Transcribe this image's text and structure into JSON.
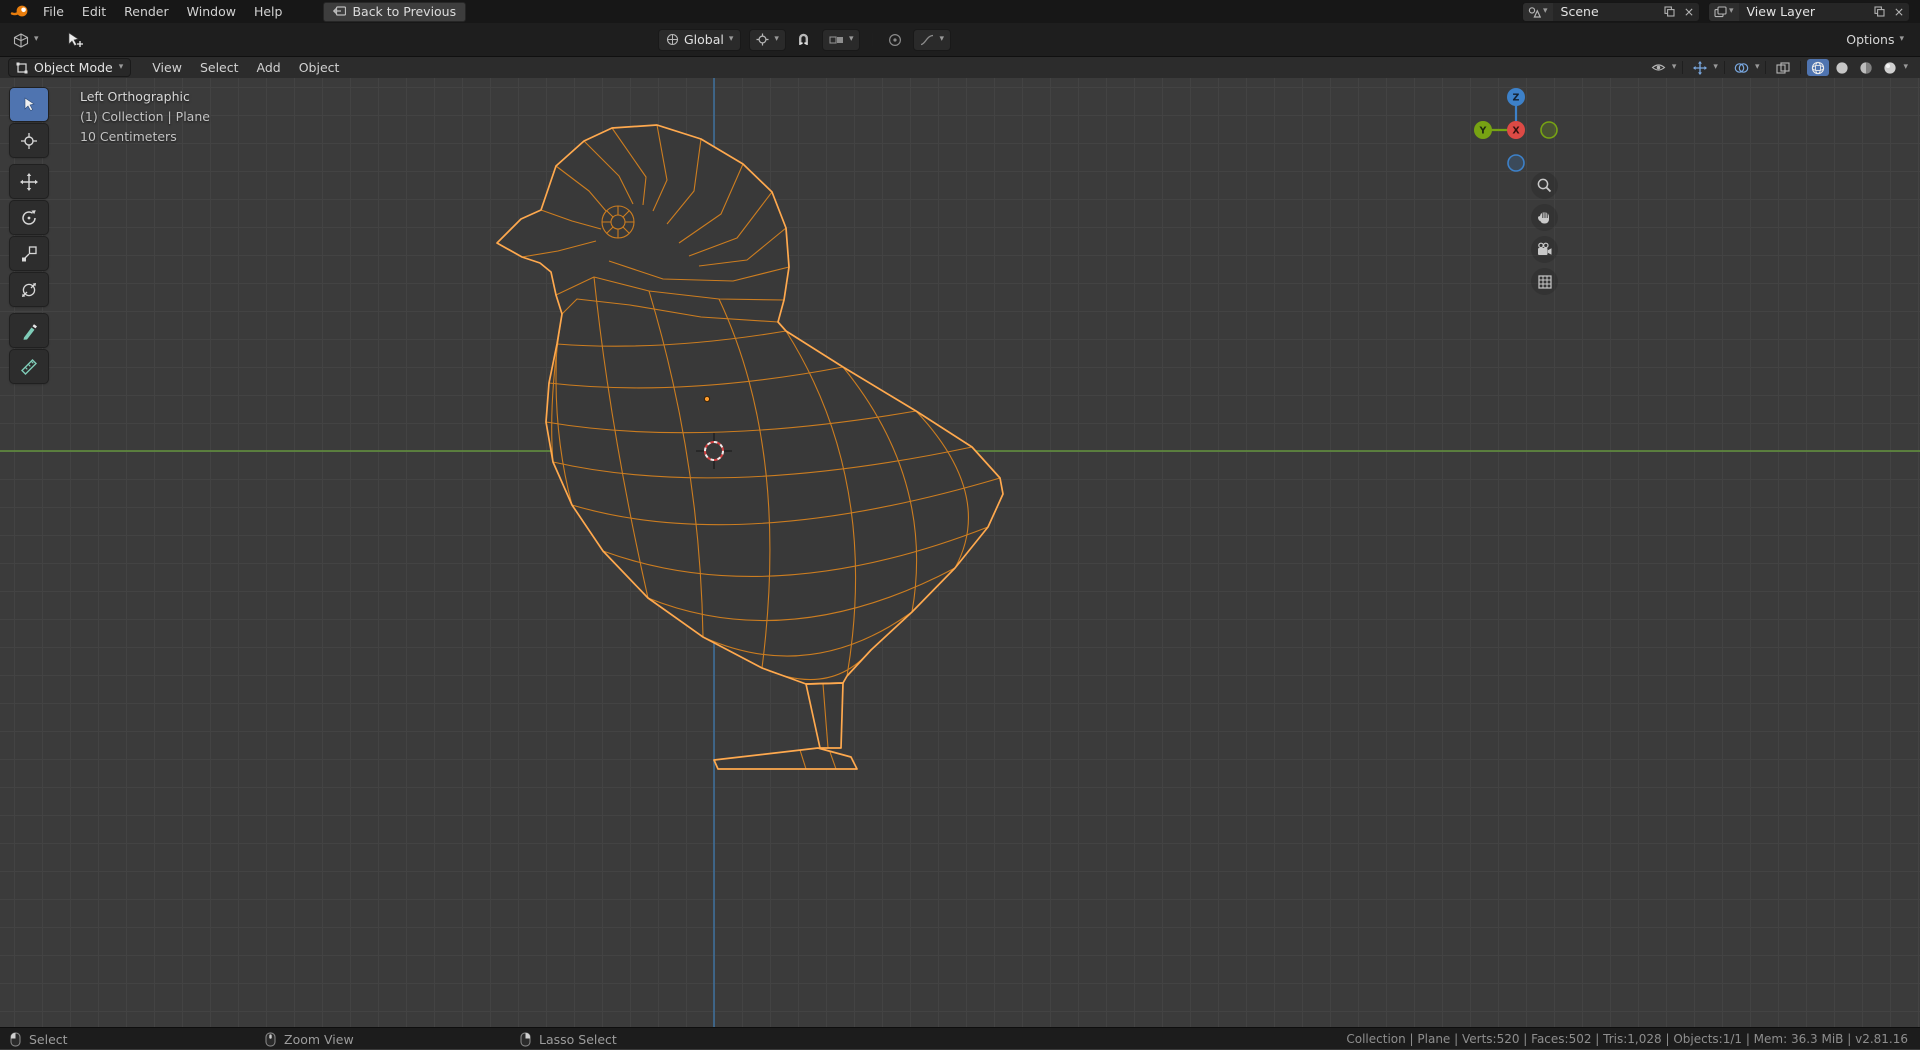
{
  "icons": {
    "chevron_down": "▾",
    "close": "×"
  },
  "colors": {
    "selected_outline": "#ffa94e",
    "wire_interior": "#cc7d20",
    "active_tool_blue": "#4f74b0",
    "axis_x_red": "#dd4a45",
    "axis_y_green": "#77a313",
    "axis_z_blue": "#3d81c9",
    "viewport_bg": "#3b3b3b"
  },
  "topbar": {
    "menus": [
      "File",
      "Edit",
      "Render",
      "Window",
      "Help"
    ],
    "back_button": "Back to Previous",
    "scene_name": "Scene",
    "view_layer_name": "View Layer"
  },
  "tool_header": {
    "transform_orientation": "Global",
    "options_label": "Options"
  },
  "viewport_header": {
    "mode": "Object Mode",
    "menus": [
      "View",
      "Select",
      "Add",
      "Object"
    ]
  },
  "viewport": {
    "view_label": "Left Orthographic",
    "context_label": "(1) Collection | Plane",
    "scale_label": "10 Centimeters",
    "gizmo": {
      "x": "X",
      "y": "Y",
      "z": "Z"
    }
  },
  "statusbar": {
    "hints": [
      "Select",
      "Zoom View",
      "Lasso Select"
    ],
    "stats": "Collection | Plane | Verts:520 | Faces:502 | Tris:1,028 | Objects:1/1 | Mem: 36.3 MiB | v2.81.16"
  }
}
